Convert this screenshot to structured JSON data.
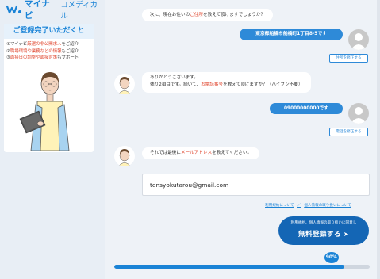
{
  "brand": {
    "name": "マイナビ",
    "sub": "コメディカル"
  },
  "promo": {
    "title": "ご登録完了いただくと",
    "items": [
      {
        "prefix": "①マイナビ",
        "highlight": "厳選の非公開求人",
        "suffix": "をご紹介"
      },
      {
        "prefix": "②",
        "highlight": "職場環境や業務などの情報",
        "suffix": "もご紹介"
      },
      {
        "prefix": "③",
        "highlight": "面接日の調整や面接対策",
        "suffix": "もサポート"
      }
    ]
  },
  "chat": {
    "q1": {
      "before": "次に、現在お住いの",
      "highlight": "ご住所",
      "after": "を教えて頂けますでしょうか？"
    },
    "a1": "東京都船橋市船橋町1丁目8-5です",
    "edit_address": "住所を修正する",
    "q2": {
      "line1": "ありがとうございます。",
      "line2_before": "残り2項目です。続いて、",
      "line2_highlight": "お電話番号",
      "line2_after": "を教えて頂けますか？（ハイフン不要）"
    },
    "a2": "09000000000です",
    "edit_phone": "電話を修正する",
    "q3": {
      "before": "それでは最後に",
      "highlight": "メールアドレス",
      "after": "を教えてください。"
    }
  },
  "form": {
    "email_value": "tensyokutarou@gmail.com"
  },
  "terms": {
    "link1": "利用規約について",
    "sep": "／",
    "link2": "個人情報の取り扱いについて"
  },
  "submit": {
    "small": "利用規約、個人情報の取り扱いに同意し",
    "main": "無料登録する",
    "arrow": "➤"
  },
  "progress": {
    "label": "90%",
    "percent": 90
  },
  "colors": {
    "brand": "#1a83d6",
    "accent": "#e0462e",
    "button": "#1466b5"
  }
}
